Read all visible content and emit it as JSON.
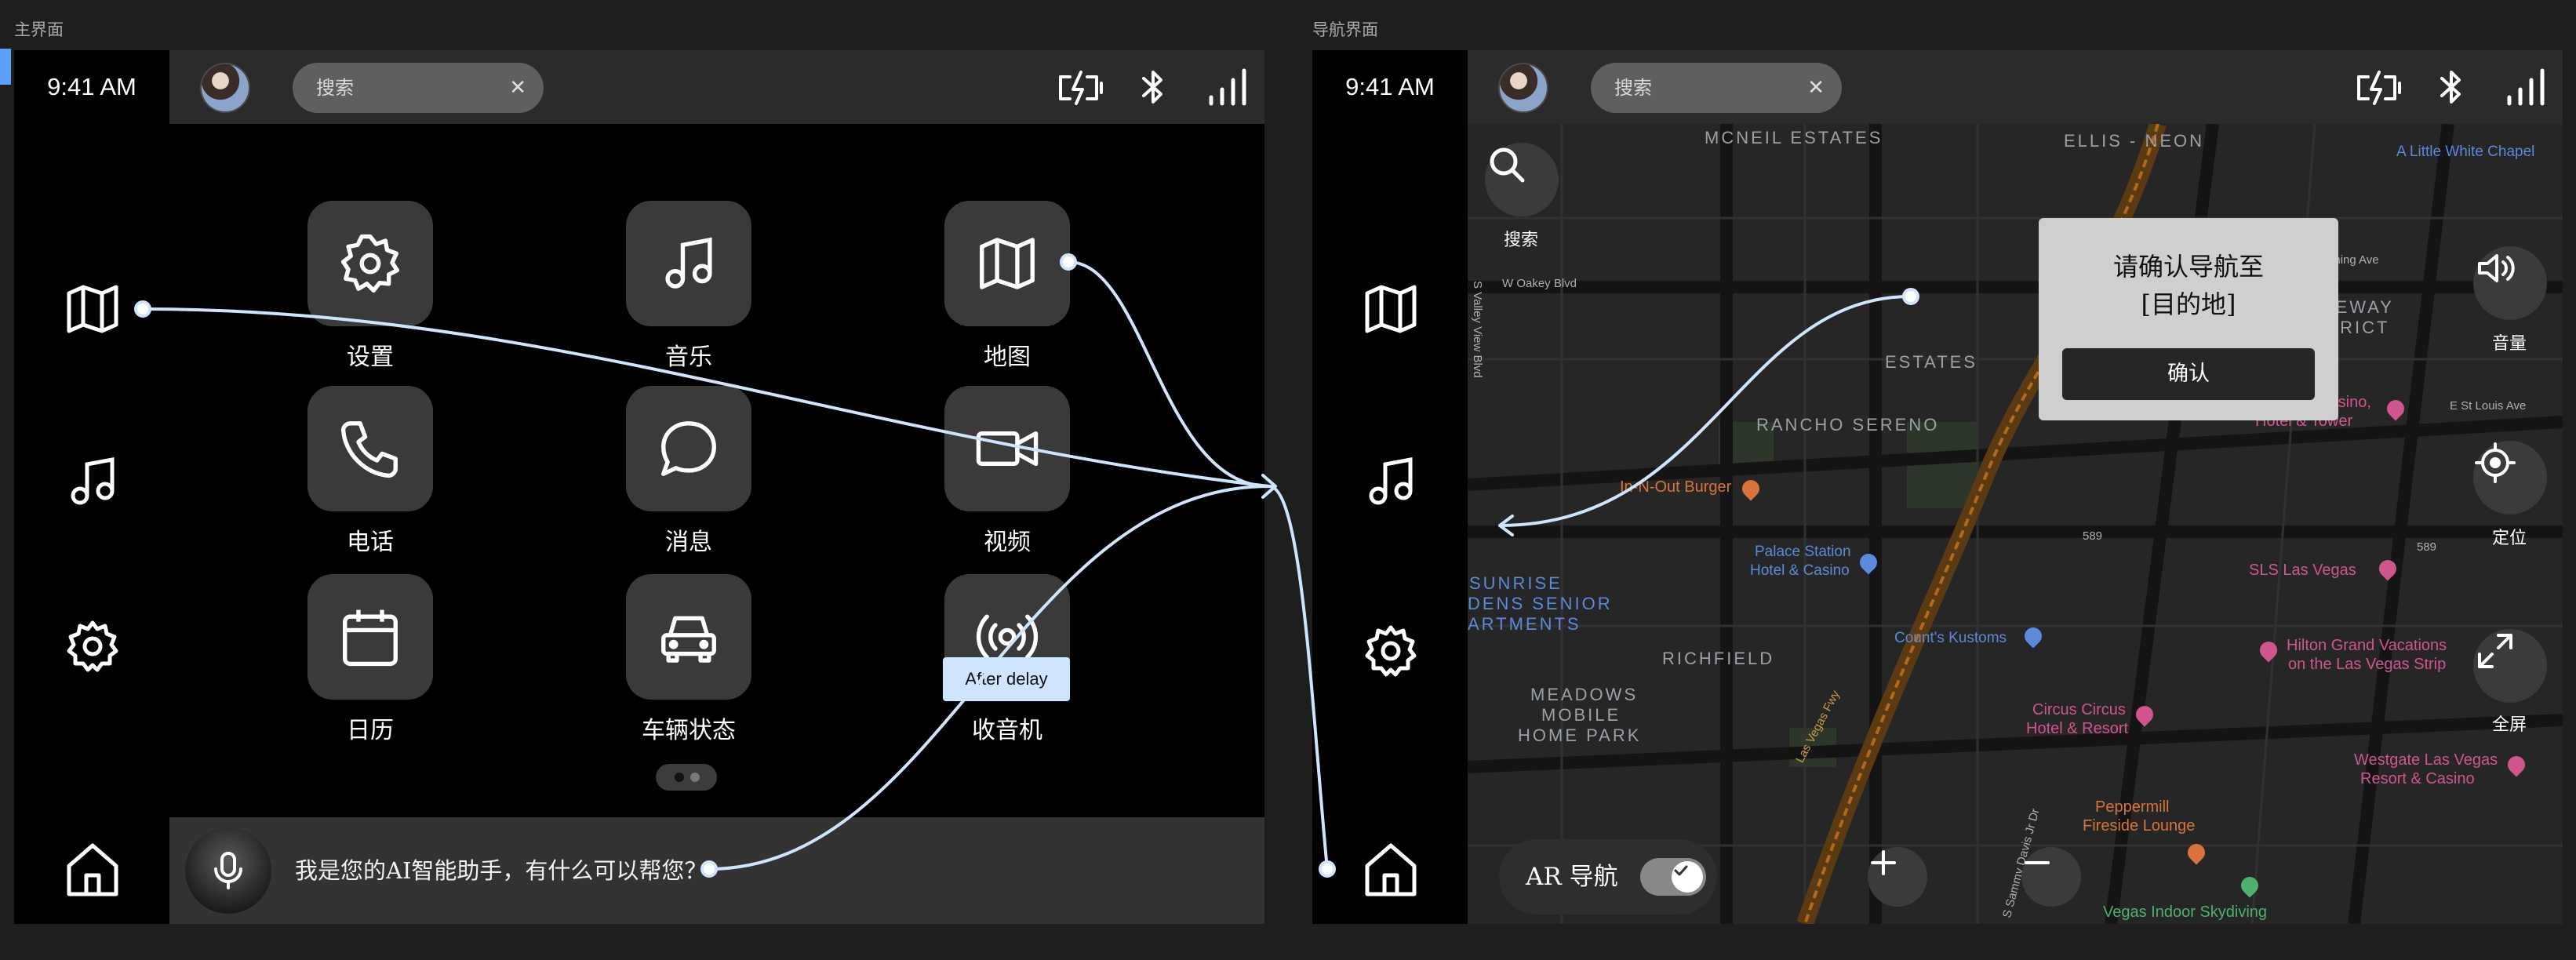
{
  "frames": {
    "main": {
      "label": "主界面"
    },
    "nav": {
      "label": "导航界面"
    }
  },
  "status": {
    "time": "9:41 AM",
    "search_placeholder": "搜索",
    "clear": "✕"
  },
  "apps": [
    {
      "label": "设置",
      "icon": "gear-icon"
    },
    {
      "label": "音乐",
      "icon": "music-icon"
    },
    {
      "label": "地图",
      "icon": "map-icon"
    },
    {
      "label": "电话",
      "icon": "phone-icon"
    },
    {
      "label": "消息",
      "icon": "message-icon"
    },
    {
      "label": "视频",
      "icon": "video-icon"
    },
    {
      "label": "日历",
      "icon": "calendar-icon"
    },
    {
      "label": "车辆状态",
      "icon": "car-icon"
    },
    {
      "label": "收音机",
      "icon": "radio-icon"
    }
  ],
  "assistant": {
    "text": "我是您的AI智能助手，有什么可以帮您？"
  },
  "prototype": {
    "delay_label": "After delay"
  },
  "map": {
    "search_label": "搜索",
    "volume_label": "音量",
    "locate_label": "定位",
    "fullscreen_label": "全屏",
    "dialog": {
      "line1": "请确认导航至",
      "line2": "[目的地]",
      "confirm": "确认"
    },
    "ar": {
      "label": "AR 导航",
      "enabled": true
    },
    "places": {
      "mcneil": "MCNEIL ESTATES",
      "ellis": "ELLIS - NEON",
      "chapel": "A Little White Chapel",
      "wyoming": "W Wyoming Ave",
      "oakey": "W Oakey Blvd",
      "gateway1": "GATEWAY",
      "gateway2": "DISTRICT",
      "estates": "ESTATES",
      "stratosphere1": "Stratosphere Casino,",
      "stratosphere2": "Hotel & Tower",
      "stlouis": "E St Louis Ave",
      "rancho": "RANCHO SERENO",
      "innout": "In-N-Out Burger",
      "palace1": "Palace Station",
      "palace2": "Hotel & Casino",
      "sunrise1": "SUNRISE",
      "sunrise2": "DENS SENIOR",
      "sunrise3": "ARTMENTS",
      "sls": "SLS Las Vegas",
      "counts": "Count's Kustoms",
      "richfield": "RICHFIELD",
      "hilton1": "Hilton Grand Vacations",
      "hilton2": "on the Las Vegas Strip",
      "meadows1": "MEADOWS",
      "meadows2": "MOBILE",
      "meadows3": "HOME PARK",
      "circus1": "Circus Circus",
      "circus2": "Hotel & Resort",
      "westgate1": "Westgate Las Vegas",
      "westgate2": "Resort & Casino",
      "peppermill1": "Peppermill",
      "peppermill2": "Fireside Lounge",
      "skydiving": "Vegas Indoor Skydiving",
      "lvfwy": "Las Vegas Fwy",
      "valleyview": "S Valley View Blvd",
      "sammy": "S Sammy Davis Jr Dr",
      "i589a": "589",
      "i589b": "589"
    }
  },
  "colors": {
    "connector": "#cfe5ff",
    "tile": "#3a3a3a",
    "statusbar": "#2b2b2b"
  }
}
